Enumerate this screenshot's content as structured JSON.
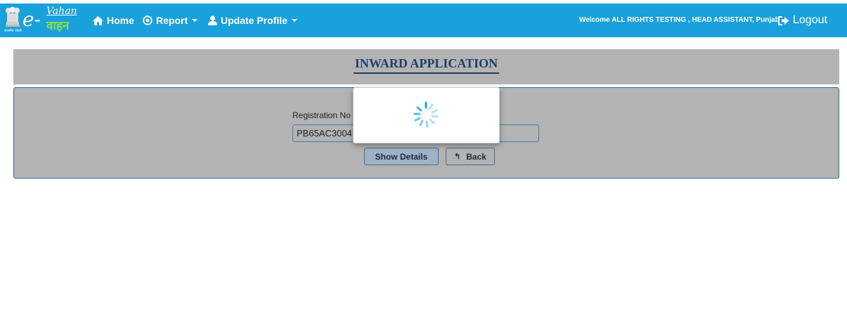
{
  "header": {
    "logo_e": "e-",
    "logo_vahan": "Vahan",
    "logo_sub": "वाहन",
    "emblem_caption": "सत्यमेव जयते",
    "nav": {
      "home": "Home",
      "report": "Report",
      "update_profile": "Update Profile"
    },
    "welcome": "Welcome ALL RIGHTS TESTING , HEAD ASSISTANT, Punjab",
    "logout": "Logout"
  },
  "page": {
    "title": "INWARD APPLICATION",
    "registration_label": "Registration No",
    "registration_value": "PB65AC3004",
    "show_details_label": "Show Details",
    "back_label": "Back"
  },
  "colors": {
    "topbar": "#1aa0db",
    "panel": "#b3b3b3",
    "title": "#1d3f66",
    "spinner": "#1aa0db"
  },
  "icons": {
    "home": "home-icon",
    "report": "target-icon",
    "profile": "user-icon",
    "logout": "logout-icon",
    "back": "back-arrow-icon",
    "loading": "spinner-icon"
  }
}
